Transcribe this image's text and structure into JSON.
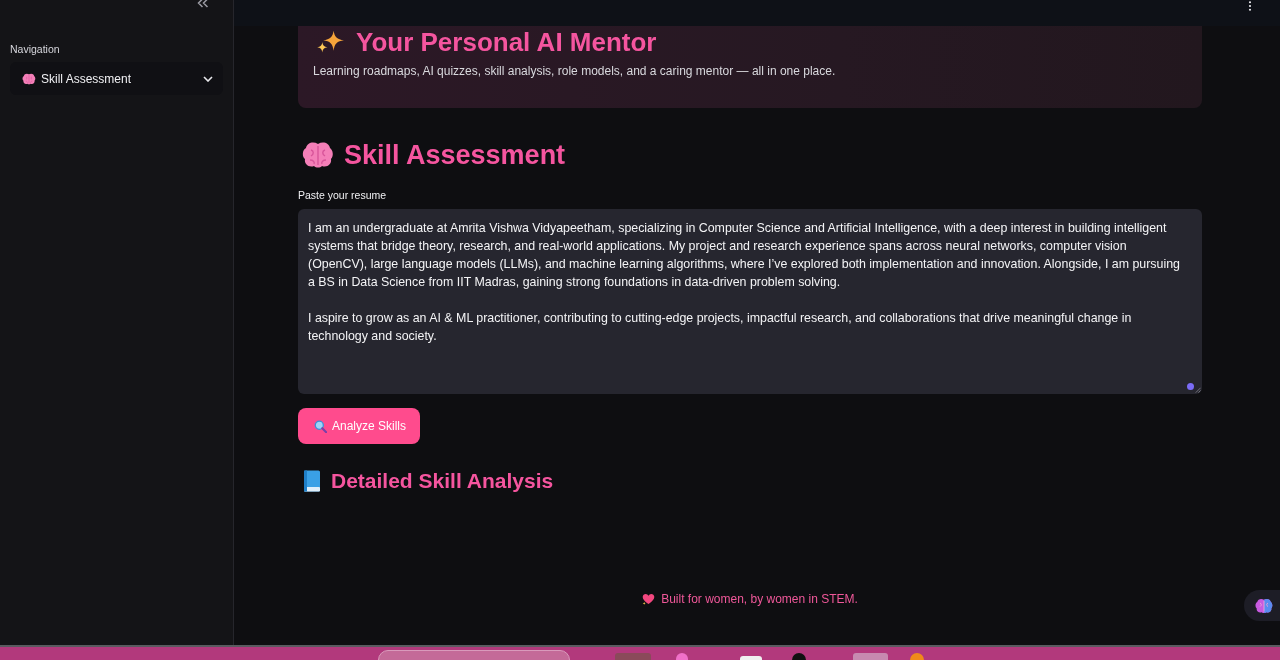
{
  "sidebar": {
    "nav_label": "Navigation",
    "nav_select": {
      "value": "Skill Assessment"
    }
  },
  "hero": {
    "title": "Your Personal AI Mentor",
    "subtitle": "Learning roadmaps, AI quizzes, skill analysis, role models, and a caring mentor — all in one place."
  },
  "section": {
    "title": "Skill Assessment"
  },
  "resume": {
    "label": "Paste your resume",
    "value": "I am an undergraduate at Amrita Vishwa Vidyapeetham, specializing in Computer Science and Artificial Intelligence, with a deep interest in building intelligent systems that bridge theory, research, and real-world applications. My project and research experience spans across neural networks, computer vision (OpenCV), large language models (LLMs), and machine learning algorithms, where I’ve explored both implementation and innovation. Alongside, I am pursuing a BS in Data Science from IIT Madras, gaining strong foundations in data-driven problem solving.\n\nI aspire to grow as an AI & ML practitioner, contributing to cutting-edge projects, impactful research, and collaborations that drive meaningful change in technology and society."
  },
  "analyze_button": {
    "label": "Analyze Skills"
  },
  "analysis": {
    "title": "Detailed Skill Analysis"
  },
  "footer": {
    "text": "Built for women, by women in STEM."
  }
}
